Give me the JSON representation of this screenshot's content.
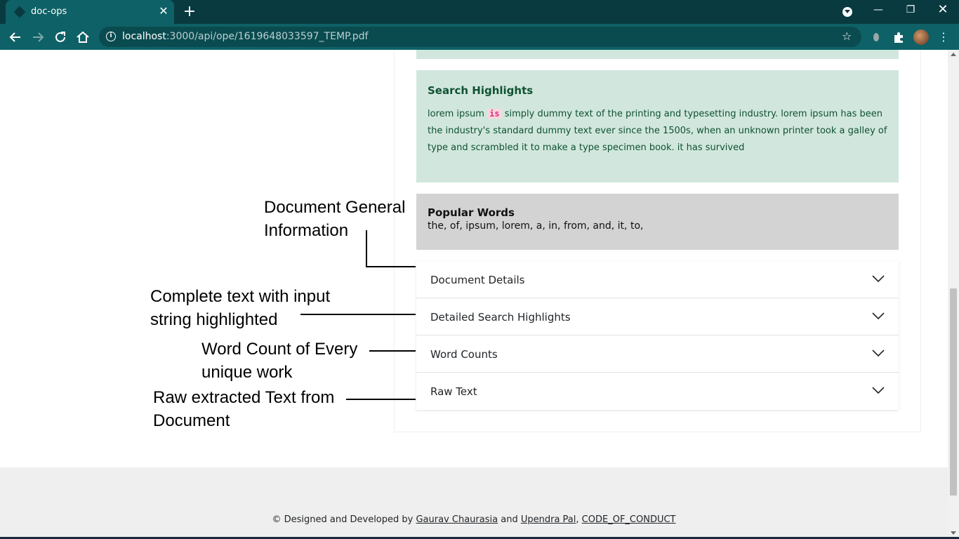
{
  "browser": {
    "tab_title": "doc-ops",
    "url_host": "localhost",
    "url_rest": ":3000/api/ope/1619648033597_TEMP.pdf"
  },
  "search_highlights": {
    "title": "Search Highlights",
    "text_before": "lorem ipsum",
    "highlight": "is",
    "text_after": "simply dummy text of the printing and typesetting industry. lorem ipsum has been the industry's standard dummy text ever since the 1500s, when an unknown printer took a galley of type and scrambled it to make a type specimen book. it has survived"
  },
  "popular_words": {
    "title": "Popular Words",
    "words": "the, of, ipsum, lorem, a, in, from, and, it, to,"
  },
  "accordion": [
    {
      "label": "Document Details"
    },
    {
      "label": "Detailed Search Highlights"
    },
    {
      "label": "Word Counts"
    },
    {
      "label": "Raw Text"
    }
  ],
  "annotations": {
    "general_line1": "Document General",
    "general_line2": "Information",
    "complete_line1": "Complete text with input",
    "complete_line2": "string highlighted",
    "wordcount_line1": "Word Count of Every",
    "wordcount_line2": "unique work",
    "raw_line1": "Raw extracted Text from",
    "raw_line2": "Document"
  },
  "footer": {
    "prefix": "© Designed and Developed by",
    "author1": "Gaurav Chaurasia",
    "and": "and",
    "author2": "Upendra Pal",
    "separator": ",",
    "conduct": "CODE_OF_CONDUCT"
  },
  "colors": {
    "chrome_dark": "#083a3f",
    "chrome_toolbar": "#0e6166",
    "highlight_bg": "#d1e7dd",
    "highlight_text": "#0f5132",
    "popular_bg": "#d3d3d3",
    "footer_bg": "#efefef"
  }
}
